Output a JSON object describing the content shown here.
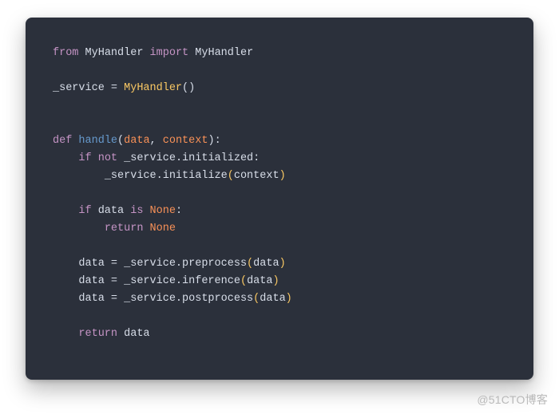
{
  "code": {
    "line1_from": "from",
    "line1_mod": "MyHandler",
    "line1_import": "import",
    "line1_name": "MyHandler",
    "line3_lhs": "_service",
    "line3_eq": " = ",
    "line3_cls": "MyHandler",
    "line3_call": "()",
    "line6_def": "def",
    "line6_fn": "handle",
    "line6_open": "(",
    "line6_p1": "data",
    "line6_comma": ", ",
    "line6_p2": "context",
    "line6_close": "):",
    "line7_if": "if",
    "line7_not": "not",
    "line7_expr": " _service.initialized:",
    "line8_call": "_service.initialize",
    "line8_open": "(",
    "line8_arg": "context",
    "line8_close": ")",
    "line10_if": "if",
    "line10_var": " data ",
    "line10_is": "is",
    "line10_sp": " ",
    "line10_none": "None",
    "line10_colon": ":",
    "line11_return": "return",
    "line11_sp": " ",
    "line11_none": "None",
    "line13_lhs": "data = _service.preprocess",
    "line13_open": "(",
    "line13_arg": "data",
    "line13_close": ")",
    "line14_lhs": "data = _service.inference",
    "line14_open": "(",
    "line14_arg": "data",
    "line14_close": ")",
    "line15_lhs": "data = _service.postprocess",
    "line15_open": "(",
    "line15_arg": "data",
    "line15_close": ")",
    "line17_return": "return",
    "line17_var": " data"
  },
  "watermark": "@51CTO博客"
}
